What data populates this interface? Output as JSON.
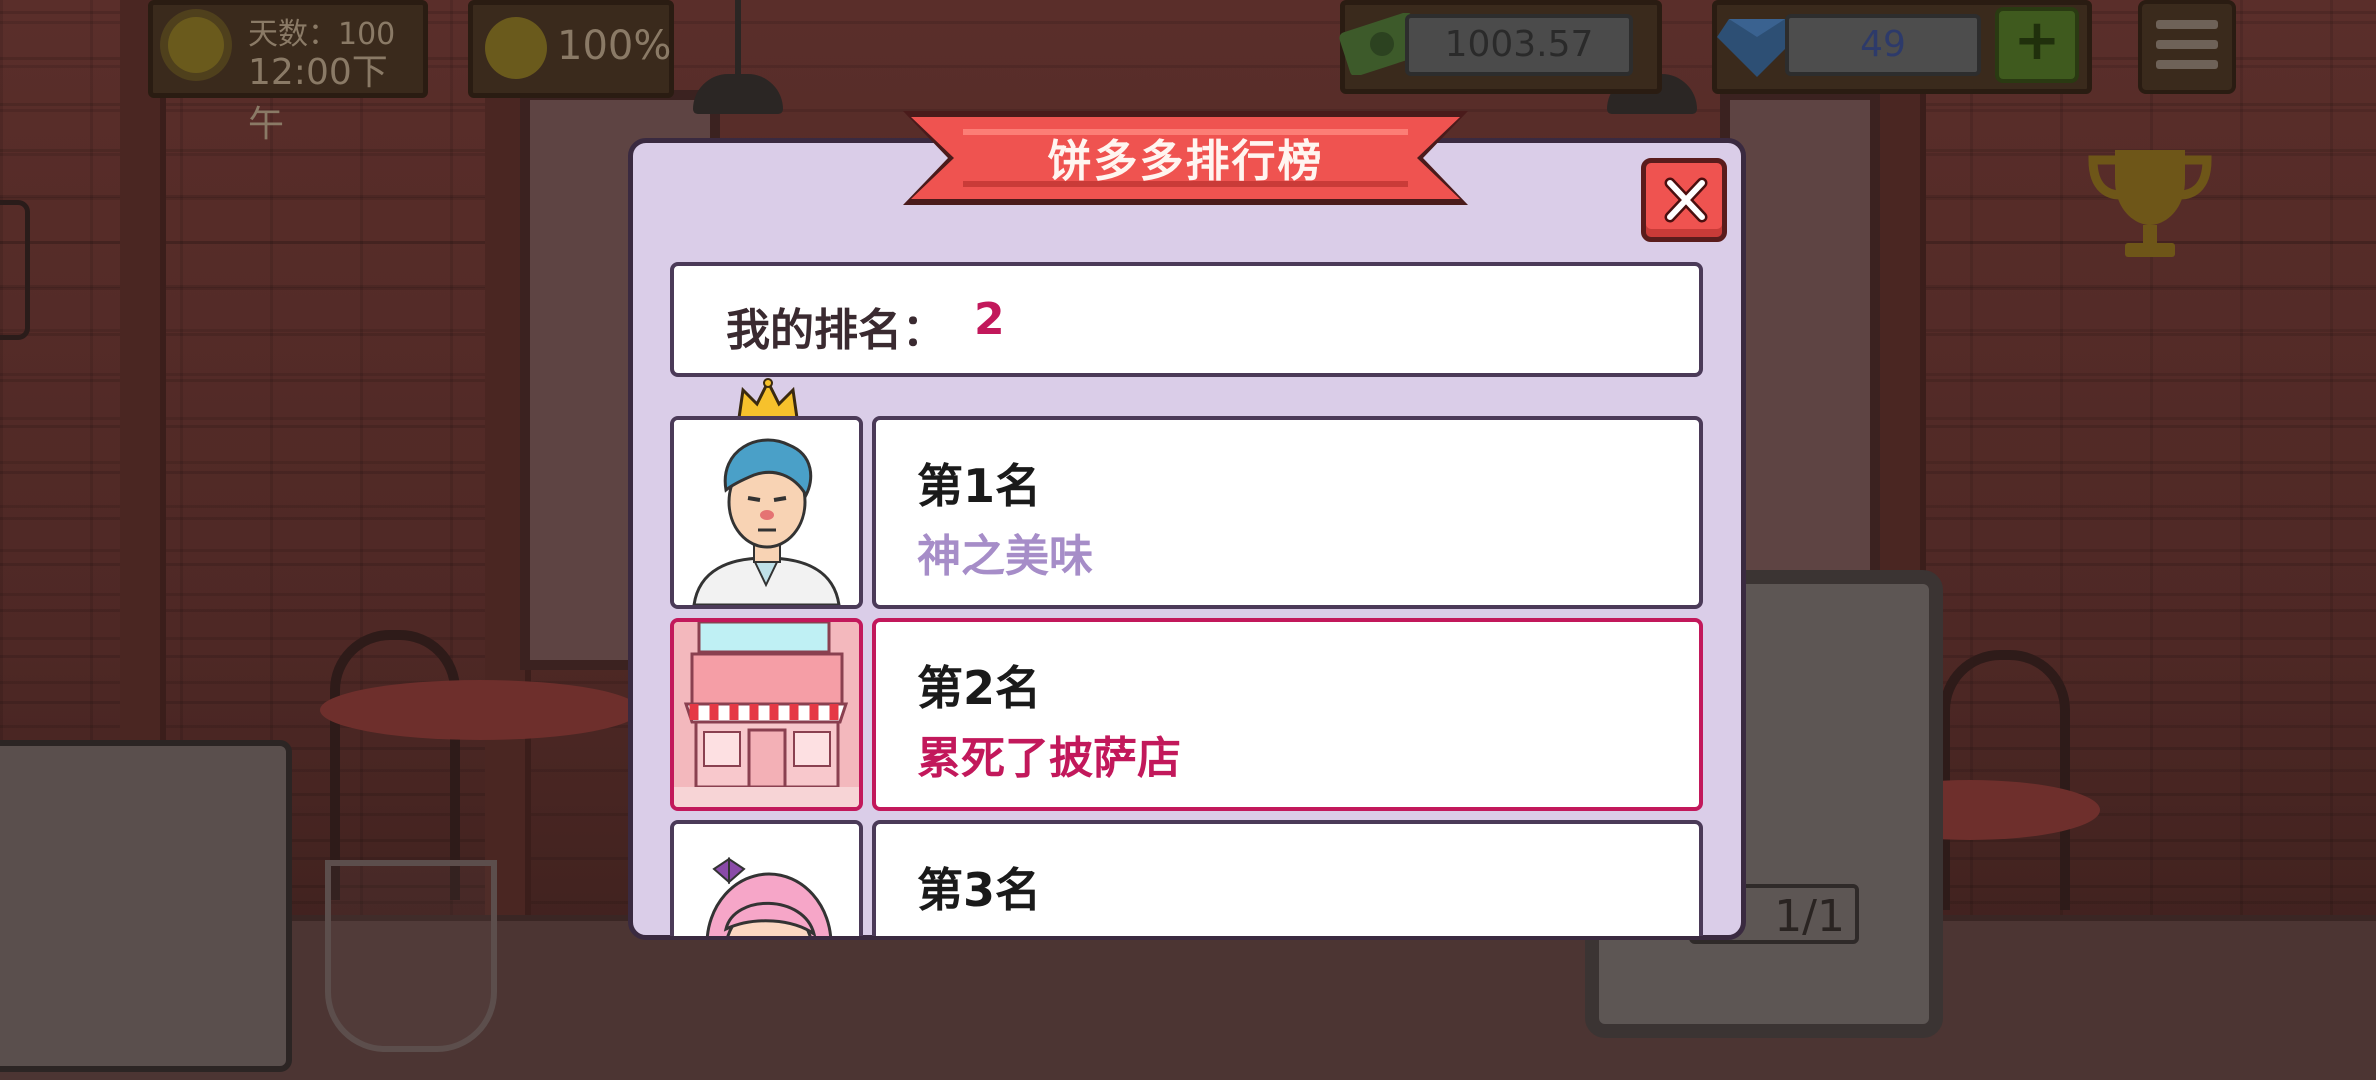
{
  "hud": {
    "days_label": "天数：",
    "days_value": "100",
    "time": "12:00下午",
    "satisfaction": "100%",
    "cash": "1003.57",
    "gems": "49",
    "add_label": "+"
  },
  "dialog": {
    "title": "饼多多排行榜",
    "my_rank_label": "我的排名：",
    "my_rank_value": "2",
    "entries": [
      {
        "rank": "第1名",
        "name": "神之美味"
      },
      {
        "rank": "第2名",
        "name": "累死了披萨店"
      },
      {
        "rank": "第3名",
        "name": "..."
      }
    ]
  },
  "background": {
    "tablet_text": "1/1"
  },
  "colors": {
    "dialog_bg": "#dacde8",
    "ribbon": "#ef5350",
    "highlight": "#c2185b",
    "shop_name": "#a68dc8"
  }
}
